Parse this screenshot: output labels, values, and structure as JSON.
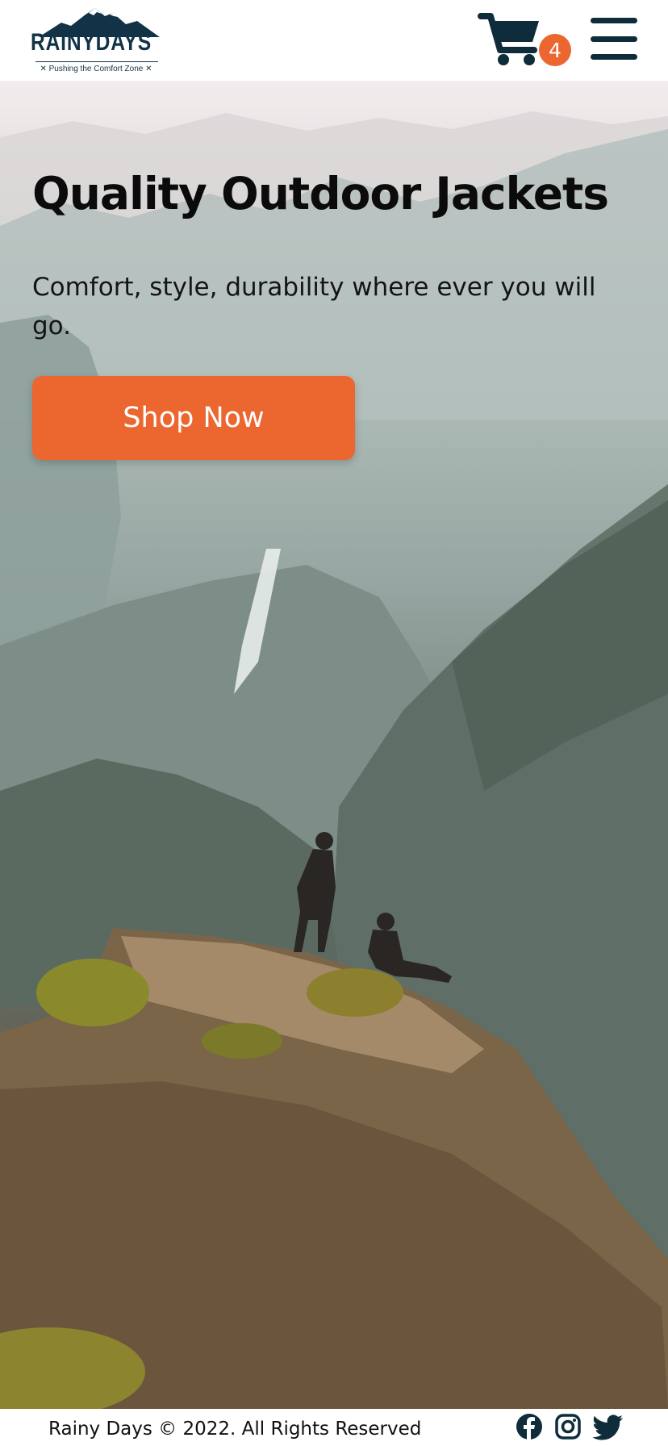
{
  "brand": {
    "name": "RAINYDAYS",
    "tagline": "✕ Pushing the Comfort Zone ✕",
    "navy": "#123347"
  },
  "header": {
    "cart_icon": "shopping-cart-icon",
    "cart_count": "4",
    "menu_icon": "hamburger-menu-icon"
  },
  "hero": {
    "title": "Quality Outdoor Jackets",
    "subtitle": "Comfort, style, durability where ever you will go.",
    "cta_label": "Shop Now",
    "accent": "#ec6630"
  },
  "footer": {
    "copyright": "Rainy Days © 2022. All Rights Reserved",
    "social": [
      "facebook-icon",
      "instagram-icon",
      "twitter-icon"
    ]
  }
}
